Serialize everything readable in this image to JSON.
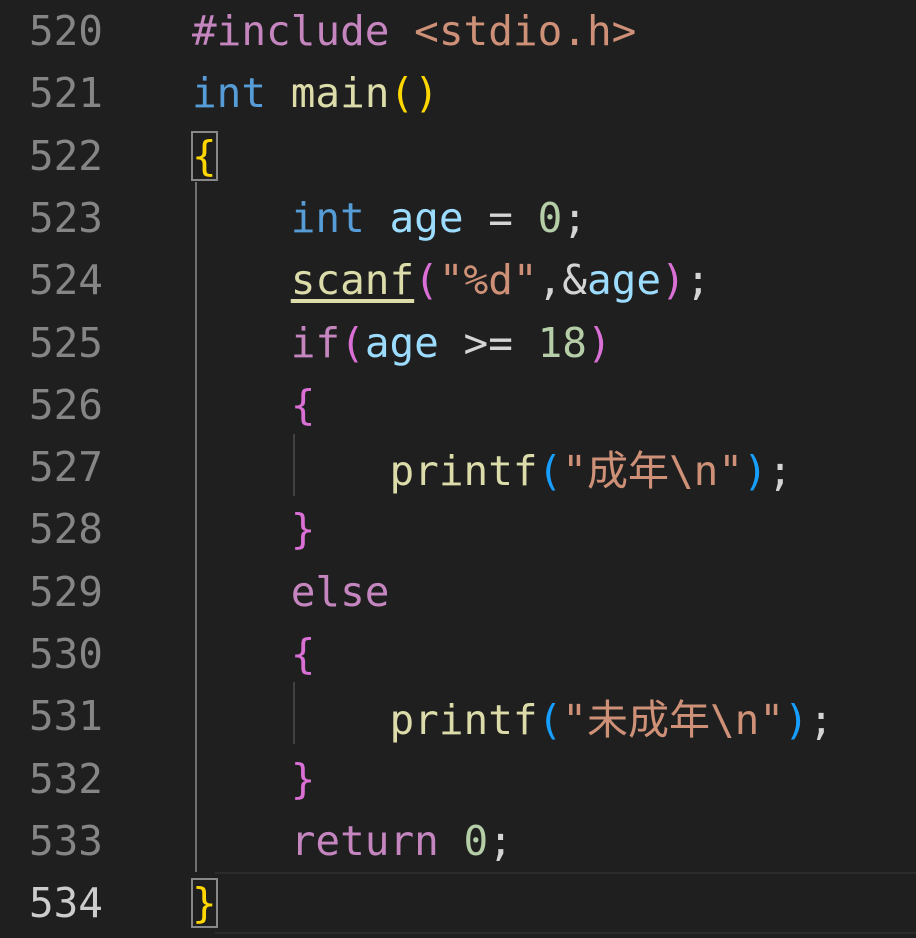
{
  "editor": {
    "lines": [
      {
        "n": "520",
        "tokens": [
          {
            "t": "#include",
            "c": "#c586c0"
          },
          {
            "t": " "
          },
          {
            "t": "<stdio.h>",
            "c": "#ce9178"
          }
        ]
      },
      {
        "n": "521",
        "tokens": [
          {
            "t": "int",
            "c": "#569cd6"
          },
          {
            "t": " "
          },
          {
            "t": "main",
            "c": "#dcdcaa"
          },
          {
            "t": "()",
            "c": "#ffd700"
          }
        ]
      },
      {
        "n": "522",
        "tokens": [
          {
            "t": "{",
            "c": "#ffd700",
            "box": true
          }
        ]
      },
      {
        "n": "523",
        "tokens": [
          {
            "t": "    "
          },
          {
            "t": "int",
            "c": "#569cd6"
          },
          {
            "t": " "
          },
          {
            "t": "age",
            "c": "#9cdcfe"
          },
          {
            "t": " = "
          },
          {
            "t": "0",
            "c": "#b5cea8"
          },
          {
            "t": ";"
          }
        ]
      },
      {
        "n": "524",
        "tokens": [
          {
            "t": "    "
          },
          {
            "t": "scanf",
            "c": "#dcdcaa",
            "u": true
          },
          {
            "t": "(",
            "c": "#da70d6"
          },
          {
            "t": "\"%d\"",
            "c": "#ce9178"
          },
          {
            "t": ",&"
          },
          {
            "t": "age",
            "c": "#9cdcfe"
          },
          {
            "t": ")",
            "c": "#da70d6"
          },
          {
            "t": ";"
          }
        ]
      },
      {
        "n": "525",
        "tokens": [
          {
            "t": "    "
          },
          {
            "t": "if",
            "c": "#c586c0"
          },
          {
            "t": "(",
            "c": "#da70d6"
          },
          {
            "t": "age",
            "c": "#9cdcfe"
          },
          {
            "t": " >= "
          },
          {
            "t": "18",
            "c": "#b5cea8"
          },
          {
            "t": ")",
            "c": "#da70d6"
          }
        ]
      },
      {
        "n": "526",
        "tokens": [
          {
            "t": "    "
          },
          {
            "t": "{",
            "c": "#da70d6"
          }
        ]
      },
      {
        "n": "527",
        "tokens": [
          {
            "t": "        "
          },
          {
            "t": "printf",
            "c": "#dcdcaa"
          },
          {
            "t": "(",
            "c": "#179fff"
          },
          {
            "t": "\"成年\\n\"",
            "c": "#ce9178"
          },
          {
            "t": ")",
            "c": "#179fff"
          },
          {
            "t": ";"
          }
        ]
      },
      {
        "n": "528",
        "tokens": [
          {
            "t": "    "
          },
          {
            "t": "}",
            "c": "#da70d6"
          }
        ]
      },
      {
        "n": "529",
        "tokens": [
          {
            "t": "    "
          },
          {
            "t": "else",
            "c": "#c586c0"
          }
        ]
      },
      {
        "n": "530",
        "tokens": [
          {
            "t": "    "
          },
          {
            "t": "{",
            "c": "#da70d6"
          }
        ]
      },
      {
        "n": "531",
        "tokens": [
          {
            "t": "        "
          },
          {
            "t": "printf",
            "c": "#dcdcaa"
          },
          {
            "t": "(",
            "c": "#179fff"
          },
          {
            "t": "\"未成年\\n\"",
            "c": "#ce9178"
          },
          {
            "t": ")",
            "c": "#179fff"
          },
          {
            "t": ";"
          }
        ]
      },
      {
        "n": "532",
        "tokens": [
          {
            "t": "    "
          },
          {
            "t": "}",
            "c": "#da70d6"
          }
        ]
      },
      {
        "n": "533",
        "tokens": [
          {
            "t": "    "
          },
          {
            "t": "return",
            "c": "#c586c0"
          },
          {
            "t": " "
          },
          {
            "t": "0",
            "c": "#b5cea8"
          },
          {
            "t": ";"
          }
        ]
      },
      {
        "n": "534",
        "active": true,
        "tokens": [
          {
            "t": "}",
            "c": "#ffd700",
            "box": true
          }
        ]
      }
    ]
  }
}
